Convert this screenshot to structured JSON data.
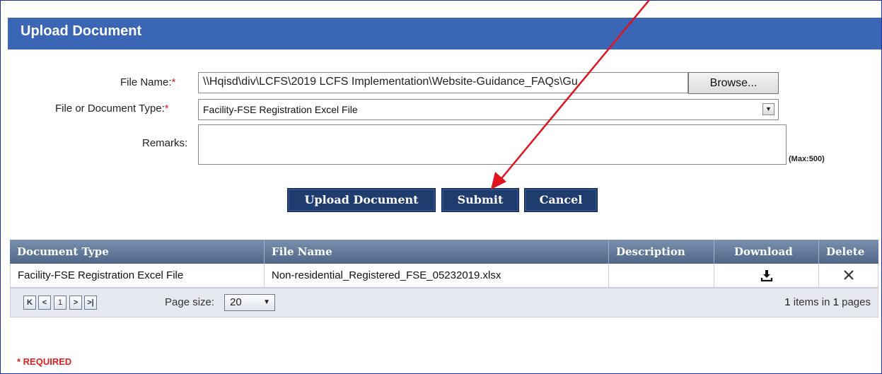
{
  "panel": {
    "title": "Upload Document"
  },
  "form": {
    "file_name_label": "File Name:",
    "required_mark": "*",
    "file_name_value": "\\\\Hqisd\\div\\LCFS\\2019 LCFS Implementation\\Website-Guidance_FAQs\\Gu",
    "browse_label": "Browse...",
    "doc_type_label": "File or Document Type:",
    "doc_type_value": "Facility-FSE Registration Excel File",
    "remarks_label": "Remarks:",
    "remarks_value": "",
    "remarks_max": "(Max:500)"
  },
  "actions": {
    "upload_label": "Upload Document",
    "submit_label": "Submit",
    "cancel_label": "Cancel"
  },
  "table": {
    "columns": [
      "Document Type",
      "File Name",
      "Description",
      "Download",
      "Delete"
    ],
    "rows": [
      {
        "document_type": "Facility-FSE Registration Excel File",
        "file_name": "Non-residential_Registered_FSE_05232019.xlsx",
        "description": ""
      }
    ]
  },
  "pager": {
    "current_page": "1",
    "page_size_label": "Page size:",
    "page_size": "20",
    "info_count": "1",
    "info_mid": " items in ",
    "info_pages": "1",
    "info_suffix": " pages"
  },
  "footer": {
    "required_note": "* REQUIRED"
  },
  "colors": {
    "header_bg": "#3a66b5",
    "button_bg": "#1f3c6e",
    "required_red": "#e02020",
    "annotation_arrow": "#e0141e"
  },
  "icons": {
    "download": "download-icon",
    "delete": "close-icon",
    "first": "first-page-icon",
    "prev": "prev-page-icon",
    "next": "next-page-icon",
    "last": "last-page-icon",
    "dropdown": "chevron-down-icon"
  }
}
